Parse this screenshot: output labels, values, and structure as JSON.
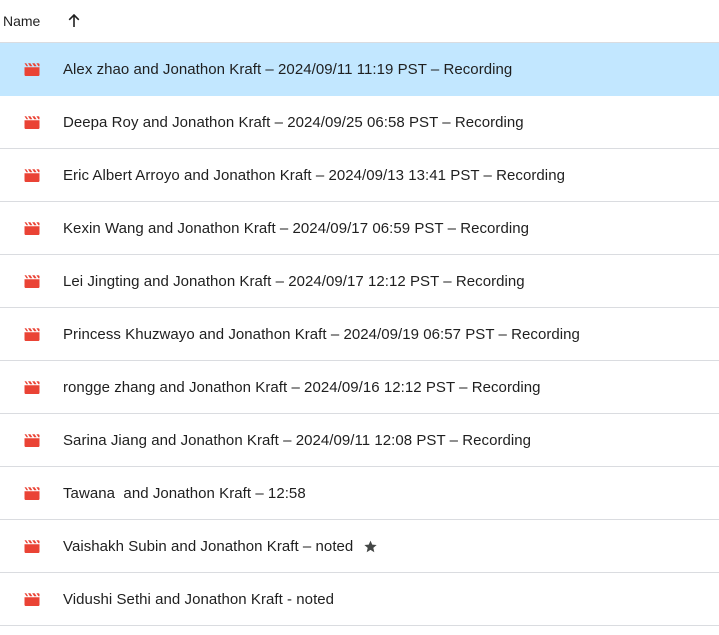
{
  "header": {
    "name_label": "Name"
  },
  "icons": {
    "sort": "arrow-up-icon",
    "file": "video-file-icon",
    "star": "star-icon"
  },
  "colors": {
    "selected_row": "#c2e7ff",
    "file_icon": "#ea4335",
    "divider": "#dadce0"
  },
  "files": [
    {
      "name": "Alex zhao and Jonathon Kraft – 2024/09/11 11:19 PST – Recording",
      "selected": true,
      "starred": false
    },
    {
      "name": "Deepa Roy and Jonathon Kraft – 2024/09/25 06:58 PST – Recording",
      "selected": false,
      "starred": false
    },
    {
      "name": "Eric Albert Arroyo and Jonathon Kraft – 2024/09/13 13:41 PST – Recording",
      "selected": false,
      "starred": false
    },
    {
      "name": "Kexin Wang and Jonathon Kraft – 2024/09/17 06:59 PST – Recording",
      "selected": false,
      "starred": false
    },
    {
      "name": "Lei Jingting and Jonathon Kraft – 2024/09/17 12:12 PST – Recording",
      "selected": false,
      "starred": false
    },
    {
      "name": "Princess Khuzwayo and Jonathon Kraft – 2024/09/19 06:57 PST – Recording",
      "selected": false,
      "starred": false
    },
    {
      "name": "rongge zhang and Jonathon Kraft – 2024/09/16 12:12 PST – Recording",
      "selected": false,
      "starred": false
    },
    {
      "name": "Sarina Jiang and Jonathon Kraft – 2024/09/11 12:08 PST – Recording",
      "selected": false,
      "starred": false
    },
    {
      "name": "Tawana  and Jonathon Kraft – 12:58",
      "selected": false,
      "starred": false
    },
    {
      "name": "Vaishakh Subin and Jonathon Kraft – noted",
      "selected": false,
      "starred": true
    },
    {
      "name": "Vidushi Sethi and Jonathon Kraft - noted",
      "selected": false,
      "starred": false
    }
  ]
}
